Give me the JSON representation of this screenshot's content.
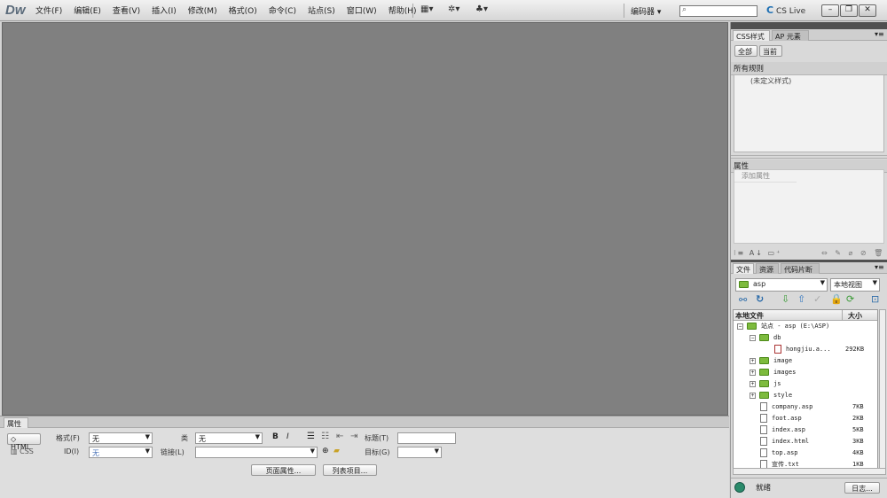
{
  "app": {
    "logo": "Dw"
  },
  "menubar": {
    "items": [
      "文件(F)",
      "编辑(E)",
      "查看(V)",
      "插入(I)",
      "修改(M)",
      "格式(O)",
      "命令(C)",
      "站点(S)",
      "窗口(W)",
      "帮助(H)"
    ],
    "workspace": "编码器",
    "cslive": "CS Live",
    "search_value": ""
  },
  "properties": {
    "tab": "属性",
    "html_btn": "HTML",
    "css_btn": "CSS",
    "format_label": "格式(F)",
    "format_value": "无",
    "class_label": "类",
    "class_value": "无",
    "bold": "B",
    "italic": "I",
    "title_label": "标题(T)",
    "id_label": "ID(I)",
    "id_value": "无",
    "link_label": "链接(L)",
    "link_value": "",
    "target_label": "目标(G)",
    "page_props_btn": "页面属性...",
    "list_item_btn": "列表项目..."
  },
  "css_panel": {
    "tabs": [
      "CSS样式",
      "AP 元素"
    ],
    "mode_buttons": [
      "全部",
      "当前"
    ],
    "all_rules_title": "所有规则",
    "undefined_style": "(未定义样式)",
    "props_title": "属性",
    "add_prop": "添加属性"
  },
  "files_panel": {
    "tabs": [
      "文件",
      "资源",
      "代码片断"
    ],
    "site_select": "asp",
    "view_select": "本地视图",
    "col_local": "本地文件",
    "col_size": "大小",
    "root": "站点 - asp (E:\\ASP)",
    "db": "db",
    "rows": [
      {
        "name": "hongjiu.a...",
        "size": "292KB"
      },
      {
        "name": "image",
        "size": ""
      },
      {
        "name": "images",
        "size": ""
      },
      {
        "name": "js",
        "size": ""
      },
      {
        "name": "style",
        "size": ""
      },
      {
        "name": "company.asp",
        "size": "7KB"
      },
      {
        "name": "foot.asp",
        "size": "2KB"
      },
      {
        "name": "index.asp",
        "size": "5KB"
      },
      {
        "name": "index.html",
        "size": "3KB"
      },
      {
        "name": "top.asp",
        "size": "4KB"
      },
      {
        "name": "宣传.txt",
        "size": "1KB"
      }
    ],
    "status_label": "就绪",
    "log_button": "日志..."
  }
}
